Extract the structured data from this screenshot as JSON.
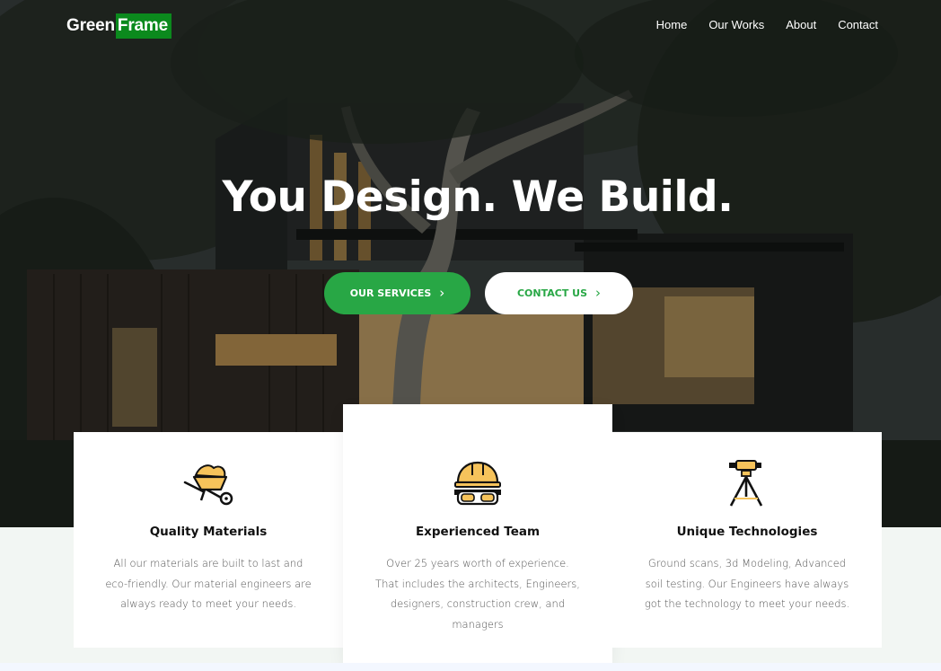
{
  "brand": {
    "name_part1": "Green",
    "name_part2": "Frame"
  },
  "nav": {
    "items": [
      "Home",
      "Our Works",
      "About",
      "Contact"
    ]
  },
  "hero": {
    "headline": "You Design. We Build.",
    "primary_button": "OUR SERVICES",
    "secondary_button": "CONTACT US"
  },
  "features": [
    {
      "icon": "wheelbarrow-icon",
      "title": "Quality Materials",
      "text": "All our materials are built to last and eco-friendly. Our material engineers are always ready to meet your needs."
    },
    {
      "icon": "hardhat-goggles-icon",
      "title": "Experienced Team",
      "text": "Over 25 years worth of experience. That includes the architects, Engineers, designers, construction crew, and managers"
    },
    {
      "icon": "theodolite-icon",
      "title": "Unique Technologies",
      "text": "Ground scans, 3d Modeling, Advanced soil testing. Our Engineers have always got the technology to meet your needs."
    }
  ],
  "colors": {
    "accent_green": "#28a745",
    "logo_green": "#0b8a1d",
    "icon_fill": "#f6c35b"
  }
}
